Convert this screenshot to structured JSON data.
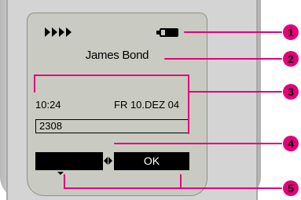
{
  "display": {
    "contact_name": "James Bond",
    "time": "10:24",
    "date": "FR 10.DEZ 04",
    "input_value": "2308",
    "softkey_left_label": "",
    "softkey_right_label": "OK"
  },
  "status": {
    "signal_icon": "signal-strength-icon",
    "battery_icon": "battery-icon",
    "battery_level": 0.75
  },
  "callouts": [
    "1",
    "2",
    "3",
    "4",
    "5"
  ],
  "colors": {
    "callout": "#e3007a",
    "screen": "#c9cbc2",
    "housing": "#d4d4d4"
  }
}
